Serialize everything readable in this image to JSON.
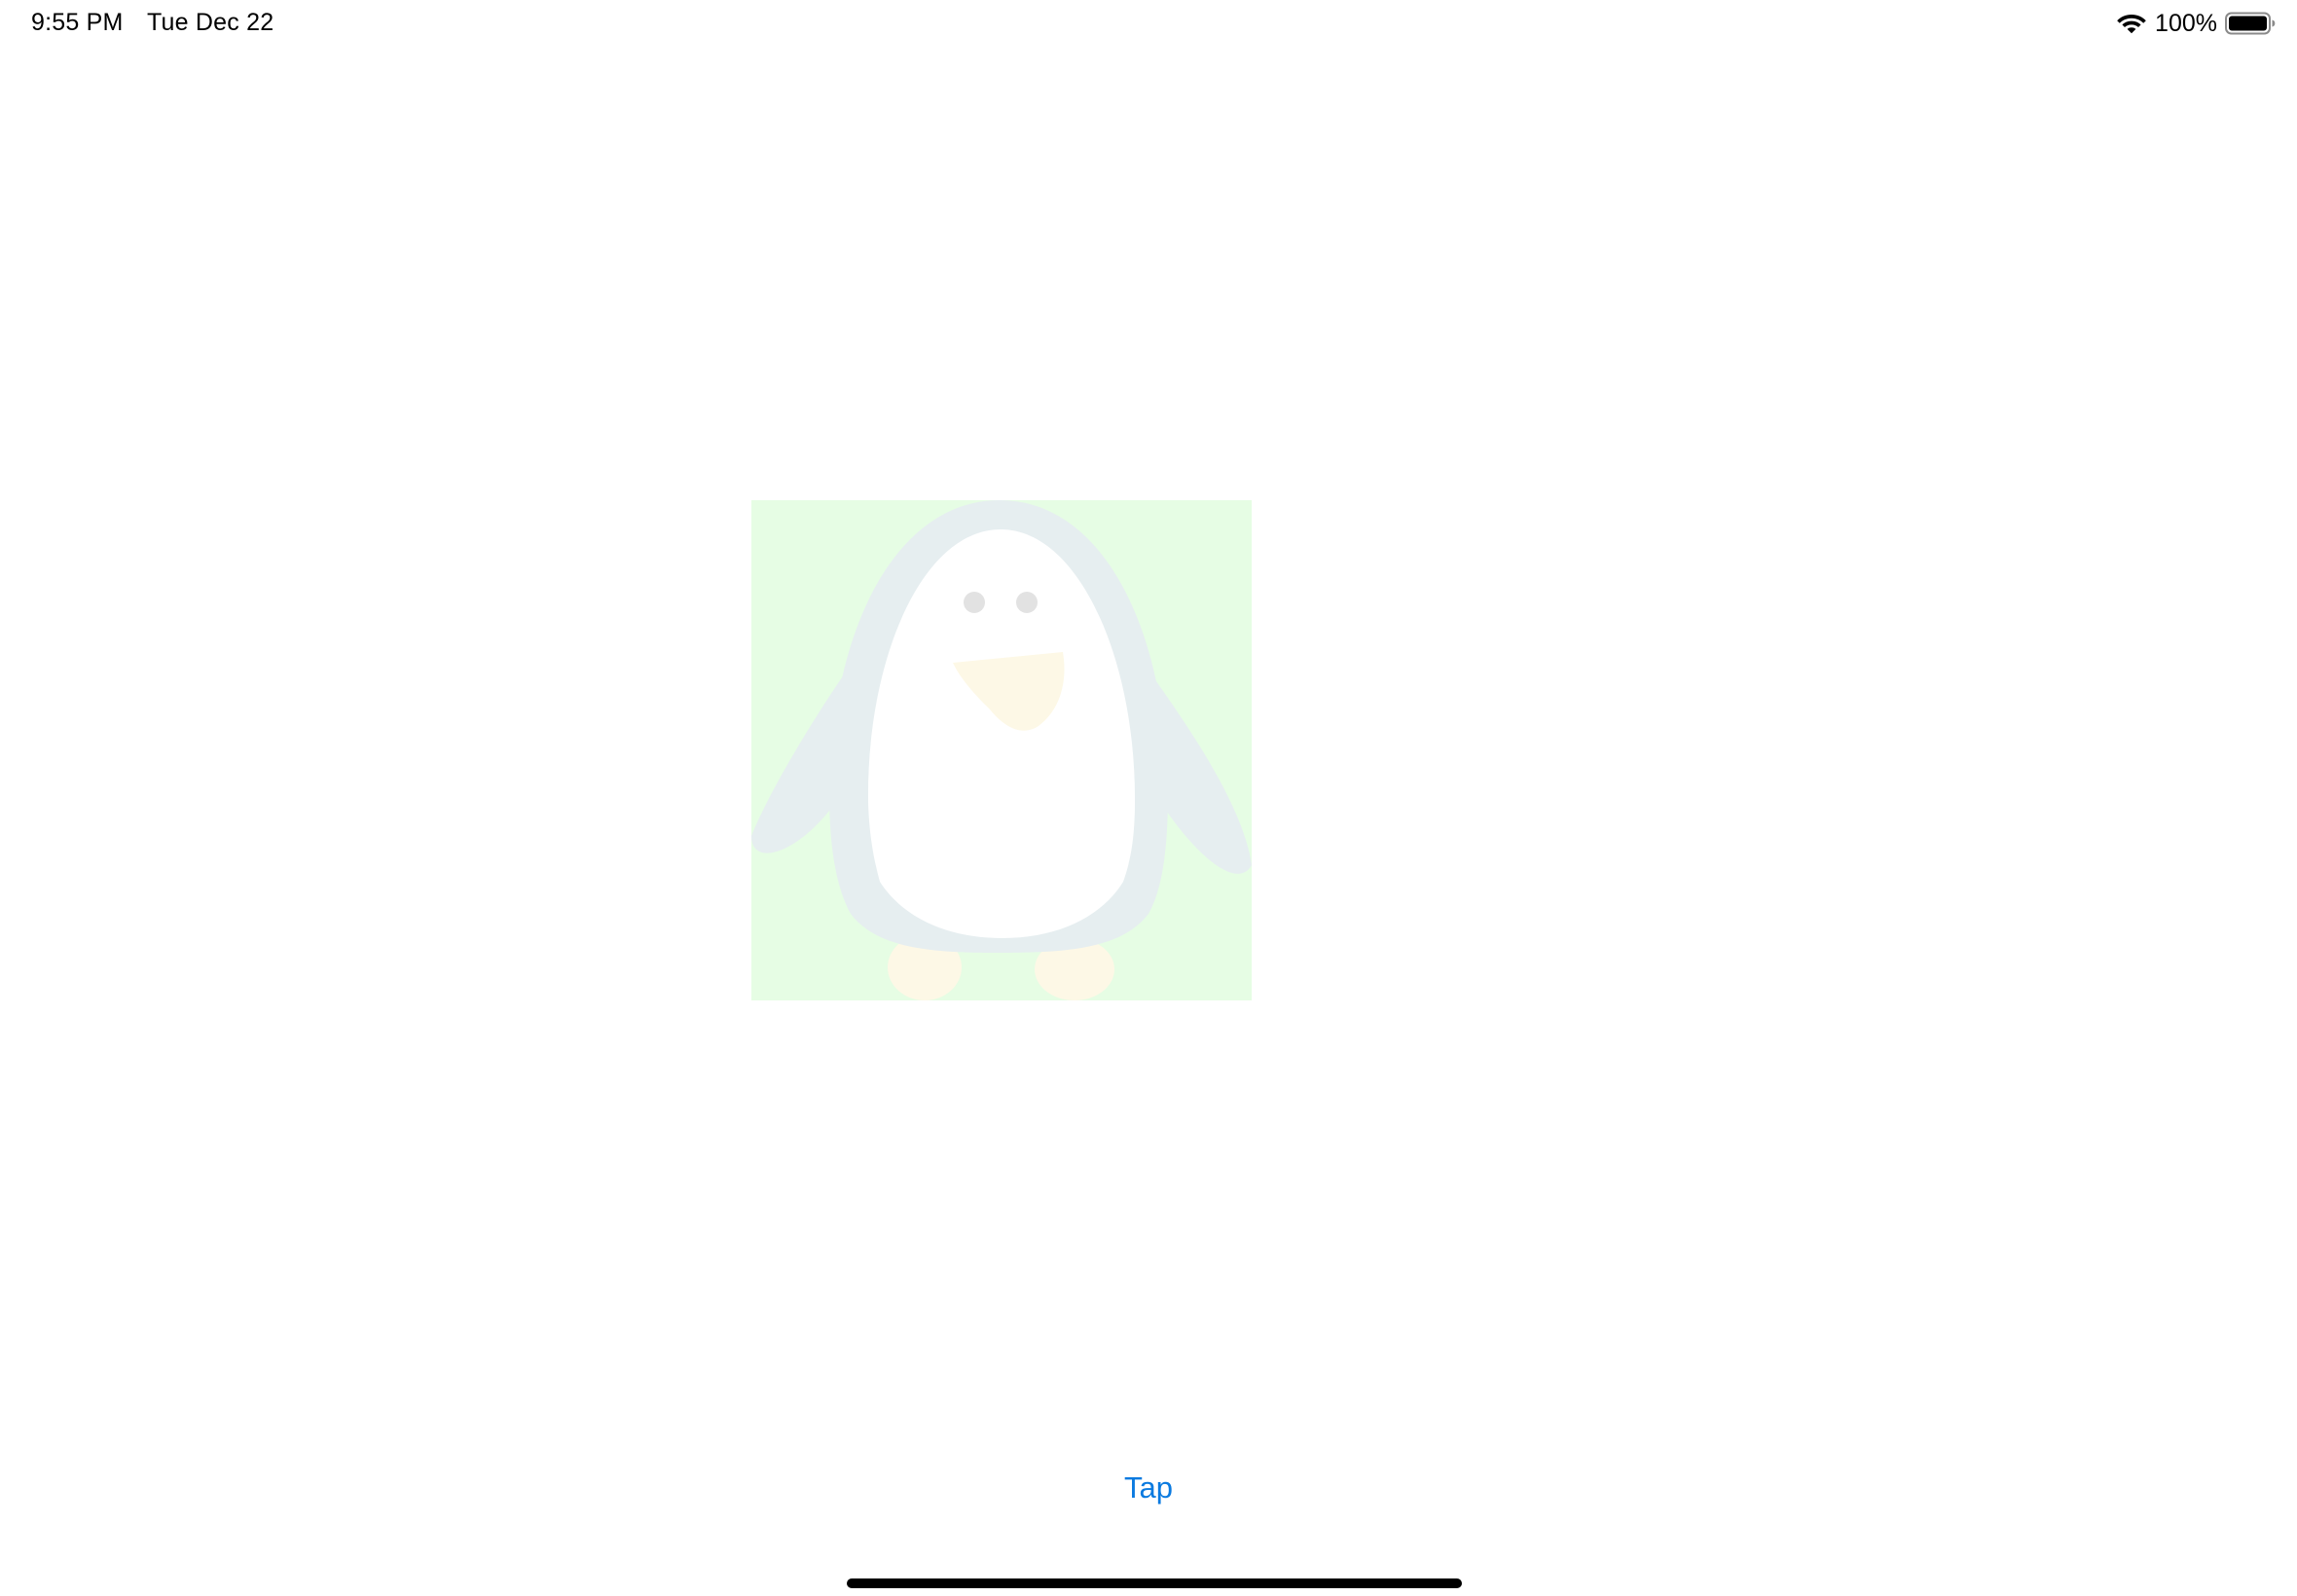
{
  "status_bar": {
    "time": "9:55 PM",
    "date": "Tue Dec 22",
    "battery_percent": "100%",
    "battery_level": 1.0,
    "wifi_icon": "wifi-icon",
    "battery_icon": "battery-full-icon"
  },
  "image": {
    "icon": "penguin-icon",
    "background_color": "#e6fde4"
  },
  "button": {
    "label": "Tap"
  },
  "colors": {
    "accent": "#0a7ae0",
    "background": "#ffffff"
  }
}
